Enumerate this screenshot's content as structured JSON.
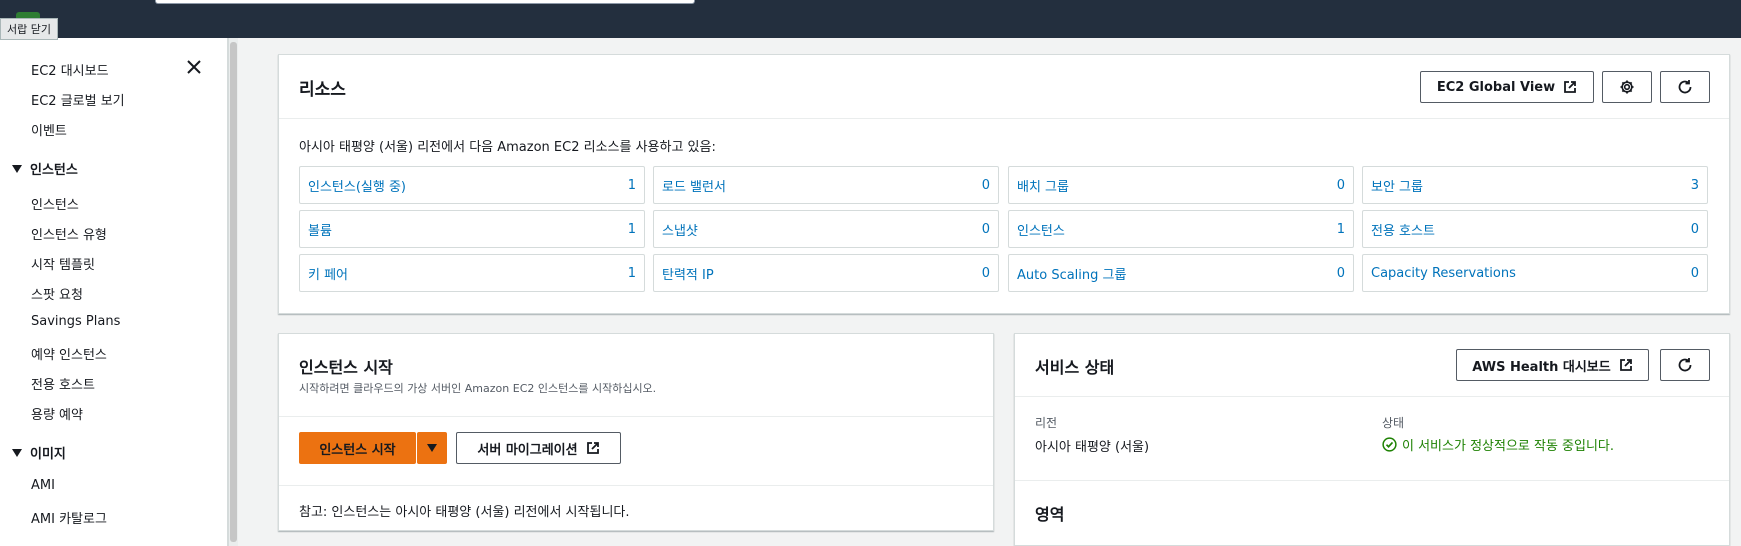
{
  "topbar": {
    "drawer_tooltip": "서랍 닫기"
  },
  "sidebar": {
    "items_top": [
      "EC2 대시보드",
      "EC2 글로벌 보기",
      "이벤트"
    ],
    "section_instances": "인스턴스",
    "instances_items": [
      "인스턴스",
      "인스턴스 유형",
      "시작 템플릿",
      "스팟 요청",
      "Savings Plans",
      "예약 인스턴스",
      "전용 호스트",
      "용량 예약"
    ],
    "section_images": "이미지",
    "images_items": [
      "AMI",
      "AMI 카탈로그"
    ]
  },
  "resources": {
    "title": "리소스",
    "global_view_label": "EC2 Global View",
    "description": "아시아 태평양 (서울) 리전에서 다음 Amazon EC2 리소스를 사용하고 있음:",
    "cells": [
      {
        "label": "인스턴스(실행 중)",
        "count": "1"
      },
      {
        "label": "로드 밸런서",
        "count": "0"
      },
      {
        "label": "배치 그룹",
        "count": "0"
      },
      {
        "label": "보안 그룹",
        "count": "3"
      },
      {
        "label": "볼륨",
        "count": "1"
      },
      {
        "label": "스냅샷",
        "count": "0"
      },
      {
        "label": "인스턴스",
        "count": "1"
      },
      {
        "label": "전용 호스트",
        "count": "0"
      },
      {
        "label": "키 페어",
        "count": "1"
      },
      {
        "label": "탄력적 IP",
        "count": "0"
      },
      {
        "label": "Auto Scaling 그룹",
        "count": "0"
      },
      {
        "label": "Capacity Reservations",
        "count": "0"
      }
    ]
  },
  "launch": {
    "title": "인스턴스 시작",
    "subtitle": "시작하려면 클라우드의 가상 서버인 Amazon EC2 인스턴스를 시작하십시오.",
    "launch_label": "인스턴스 시작",
    "migrate_label": "서버 마이그레이션",
    "note": "참고: 인스턴스는 아시아 태평양 (서울) 리전에서 시작됩니다."
  },
  "service": {
    "title": "서비스 상태",
    "health_label": "AWS Health 대시보드",
    "region_label": "리전",
    "region_value": "아시아 태평양 (서울)",
    "status_label": "상태",
    "status_value": "이 서비스가 정상적으로 작동 중입니다.",
    "zones_title": "영역"
  },
  "colors": {
    "accent": "#ec7211",
    "link": "#0073bb",
    "ok": "#1d8102",
    "topbar": "#232f3e"
  }
}
